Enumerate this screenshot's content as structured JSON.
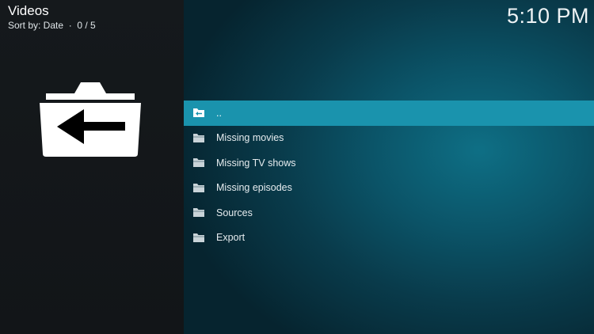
{
  "header": {
    "title": "Videos",
    "sort_label": "Sort by: Date",
    "separator": "·",
    "counter": "0 / 5"
  },
  "clock": "5:10 PM",
  "sidebar": {
    "icon": "folder-back-icon"
  },
  "list": {
    "items": [
      {
        "label": "..",
        "icon": "folder-back-icon",
        "focused": true
      },
      {
        "label": "Missing movies",
        "icon": "folder-icon"
      },
      {
        "label": "Missing TV shows",
        "icon": "folder-icon"
      },
      {
        "label": "Missing episodes",
        "icon": "folder-icon"
      },
      {
        "label": "Sources",
        "icon": "folder-icon"
      },
      {
        "label": "Export",
        "icon": "folder-icon"
      }
    ]
  },
  "colors": {
    "sidebar_bg": "#15191c",
    "main_bg": "#0b5468",
    "focus_bar": "#1a93ad",
    "text": "#ffffff"
  }
}
